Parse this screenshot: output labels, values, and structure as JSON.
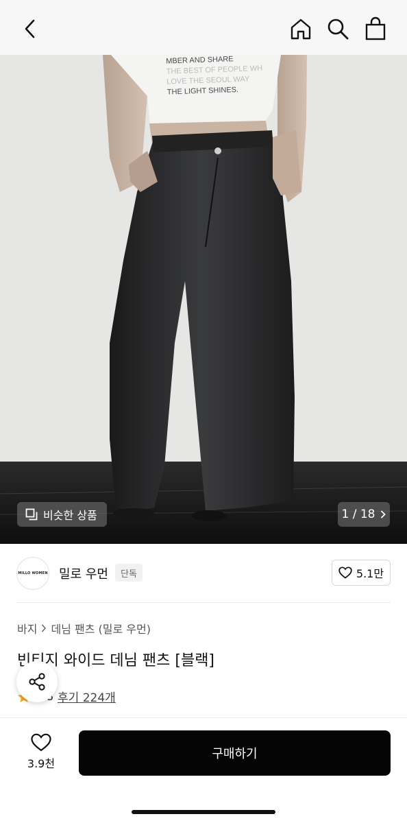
{
  "topbar": {
    "icons": [
      "back-arrow-icon",
      "home-icon",
      "search-icon",
      "shopping-bag-icon"
    ]
  },
  "hero": {
    "shirt_print_lines": [
      "MBER AND SHARE",
      "THE BEST OF PEOPLE WH",
      "LOVE THE SEOUL WAY",
      "THE LIGHT SHINES."
    ],
    "similar_label": "비슷한 상품",
    "counter": "1 / 18"
  },
  "brand": {
    "logo_text": "MILLO WOMEN",
    "name": "밀로 우먼",
    "tag": "단독",
    "likes": "5.1만"
  },
  "product": {
    "breadcrumb": [
      "바지",
      "데님 팬츠 (밀로 우먼)"
    ],
    "title": "빈티지 와이드 데님 팬츠 [블랙]",
    "rating": "4.8",
    "reviews": "후기 224개"
  },
  "bottom_bar": {
    "wish_count": "3.9천",
    "buy_label": "구매하기"
  },
  "colors": {
    "accent_star": "#f5a623",
    "buy_button": "#050505",
    "topbar_bg": "#f7f7f7"
  }
}
